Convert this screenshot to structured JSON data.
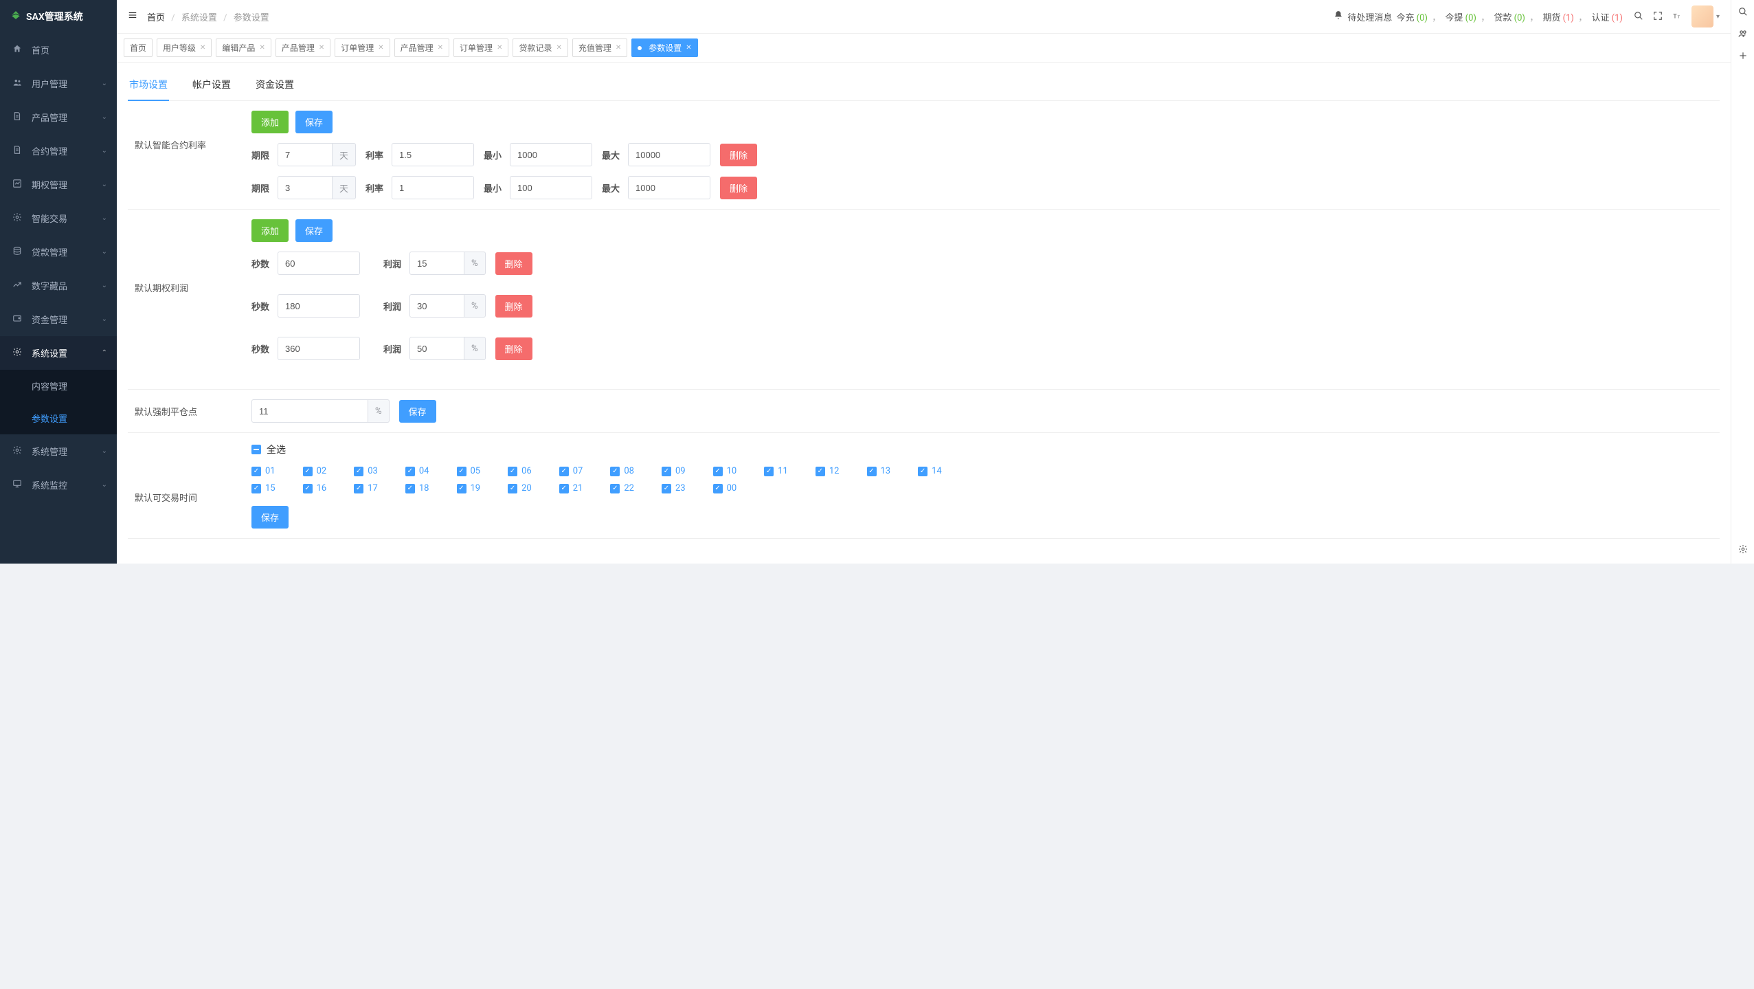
{
  "app_title": "SAX管理系统",
  "sidebar": {
    "items": [
      {
        "label": "首页",
        "icon": "home"
      },
      {
        "label": "用户管理",
        "icon": "users",
        "expandable": true
      },
      {
        "label": "产品管理",
        "icon": "doc",
        "expandable": true
      },
      {
        "label": "合约管理",
        "icon": "doc",
        "expandable": true
      },
      {
        "label": "期权管理",
        "icon": "chart",
        "expandable": true
      },
      {
        "label": "智能交易",
        "icon": "gear",
        "expandable": true
      },
      {
        "label": "贷款管理",
        "icon": "money",
        "expandable": true
      },
      {
        "label": "数字藏品",
        "icon": "nft",
        "expandable": true
      },
      {
        "label": "资金管理",
        "icon": "wallet",
        "expandable": true
      },
      {
        "label": "系统设置",
        "icon": "gear",
        "expandable": true,
        "expanded": true,
        "children": [
          {
            "label": "内容管理"
          },
          {
            "label": "参数设置",
            "active": true
          }
        ]
      },
      {
        "label": "系统管理",
        "icon": "gear",
        "expandable": true
      },
      {
        "label": "系统监控",
        "icon": "monitor",
        "expandable": true
      }
    ]
  },
  "breadcrumb": [
    "首页",
    "系统设置",
    "参数设置"
  ],
  "top_status": {
    "label": "待处理消息",
    "items": [
      {
        "label": "今充",
        "count": "(0)",
        "cls": "green"
      },
      {
        "label": "今提",
        "count": "(0)",
        "cls": "green"
      },
      {
        "label": "贷款",
        "count": "(0)",
        "cls": "green"
      },
      {
        "label": "期货",
        "count": "(1)",
        "cls": "red"
      },
      {
        "label": "认证",
        "count": "(1)",
        "cls": "red"
      }
    ]
  },
  "tabs": [
    {
      "label": "首页",
      "closable": false
    },
    {
      "label": "用户等级",
      "closable": true
    },
    {
      "label": "编辑产品",
      "closable": true
    },
    {
      "label": "产品管理",
      "closable": true
    },
    {
      "label": "订单管理",
      "closable": true
    },
    {
      "label": "产品管理",
      "closable": true
    },
    {
      "label": "订单管理",
      "closable": true
    },
    {
      "label": "贷款记录",
      "closable": true
    },
    {
      "label": "充值管理",
      "closable": true
    },
    {
      "label": "参数设置",
      "closable": true,
      "active": true
    }
  ],
  "sub_tabs": [
    {
      "label": "市场设置",
      "active": true
    },
    {
      "label": "帐户设置"
    },
    {
      "label": "资金设置"
    }
  ],
  "buttons": {
    "add": "添加",
    "save": "保存",
    "delete": "删除"
  },
  "labels": {
    "section1": "默认智能合约利率",
    "section2": "默认期权利润",
    "section3": "默认强制平仓点",
    "section4": "默认可交易时间",
    "period": "期限",
    "day": "天",
    "rate": "利率",
    "min": "最小",
    "max": "最大",
    "seconds": "秒数",
    "profit": "利润",
    "percent": "%",
    "select_all": "全选"
  },
  "contract_rates": [
    {
      "period": "7",
      "rate": "1.5",
      "min": "1000",
      "max": "10000"
    },
    {
      "period": "3",
      "rate": "1",
      "min": "100",
      "max": "1000"
    }
  ],
  "option_profits": [
    {
      "seconds": "60",
      "profit": "15"
    },
    {
      "seconds": "180",
      "profit": "30"
    },
    {
      "seconds": "360",
      "profit": "50"
    }
  ],
  "force_close": "11",
  "trade_hours": [
    "01",
    "02",
    "03",
    "04",
    "05",
    "06",
    "07",
    "08",
    "09",
    "10",
    "11",
    "12",
    "13",
    "14",
    "15",
    "16",
    "17",
    "18",
    "19",
    "20",
    "21",
    "22",
    "23",
    "00"
  ]
}
